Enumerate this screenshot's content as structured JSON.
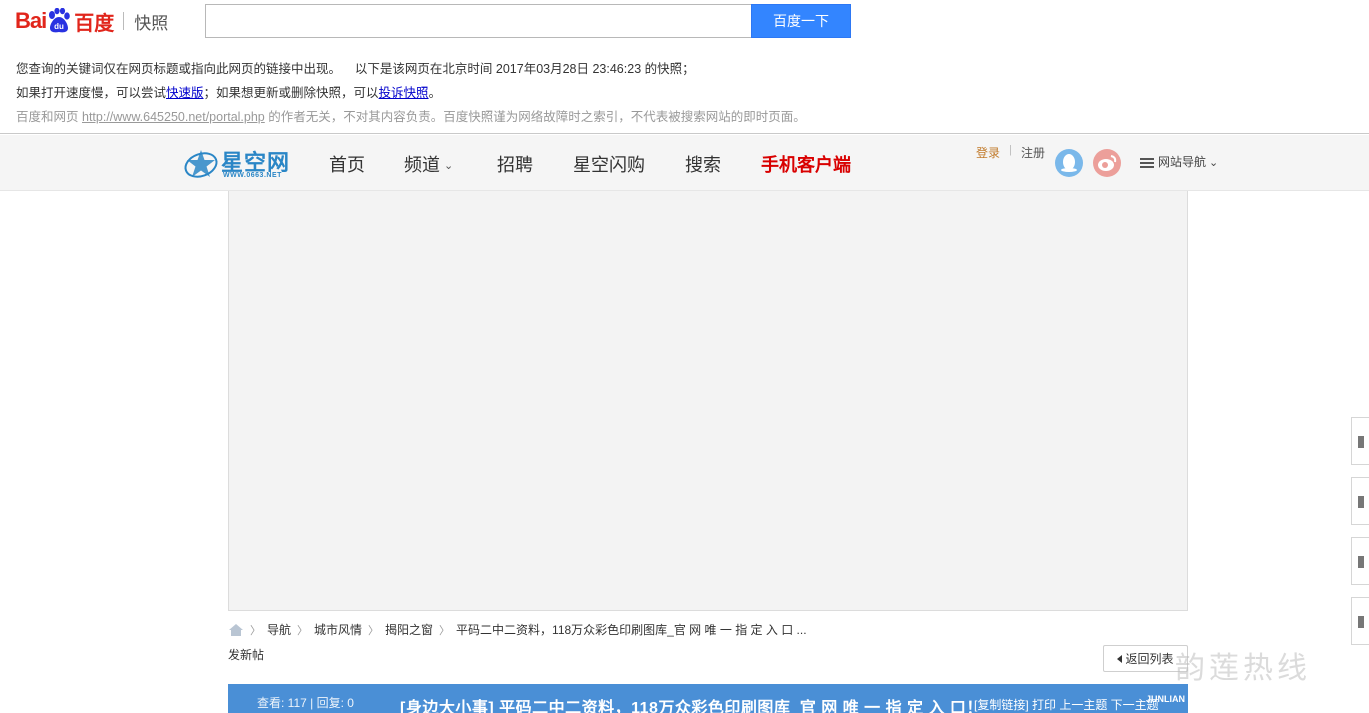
{
  "baidu": {
    "logo_bai": "Bai",
    "logo_du_cn": "百度",
    "logo_snapshot": "快照",
    "search_value": "",
    "search_button": "百度一下",
    "line1_a": "您查询的关键词仅在网页标题或指向此网页的链接中出现。",
    "line1_b": "以下是该网页在北京时间 2017年03月28日 23:46:23 的快照；",
    "line2_a": "如果打开速度慢，可以尝试",
    "line2_link1": "快速版",
    "line2_b": "；如果想更新或删除快照，可以",
    "line2_link2": "投诉快照",
    "line2_c": "。",
    "line3_a": "百度和网页",
    "line3_link": "http://www.645250.net/portal.php",
    "line3_b": "的作者无关，不对其内容负责。百度快照谨为网络故障时之索引，不代表被搜索网站的即时页面。"
  },
  "site": {
    "logo_name": "星空网",
    "logo_url": "WWW.0663.NET",
    "nav": {
      "home": "首页",
      "channel": "频道",
      "jobs": "招聘",
      "flash_buy": "星空闪购",
      "search": "搜索",
      "mobile": "手机客户端"
    },
    "login": "登录",
    "register": "注册",
    "site_guide": "网站导航",
    "colors": {
      "brand_blue": "#2a86c6",
      "mobile_red": "#d90000",
      "thread_bar": "#4a8fd6"
    }
  },
  "breadcrumb": {
    "items": [
      "导航",
      "城市风情",
      "揭阳之窗",
      "平码二中二资料，118万众彩色印刷图库_官 网 唯 一 指 定 入 口 ..."
    ]
  },
  "new_post": "发新帖",
  "back_button": "返回列表",
  "watermark": "韵莲热线",
  "thread": {
    "stats": "查看: 117 | 回复: 0",
    "title": "[身边大小事] 平码二中二资料，118万众彩色印刷图库_官 网 唯 一 指 定 入 口！",
    "tools": "[复制链接] 打印 上一主题 下一主题",
    "brand": "JUNLIAN"
  }
}
